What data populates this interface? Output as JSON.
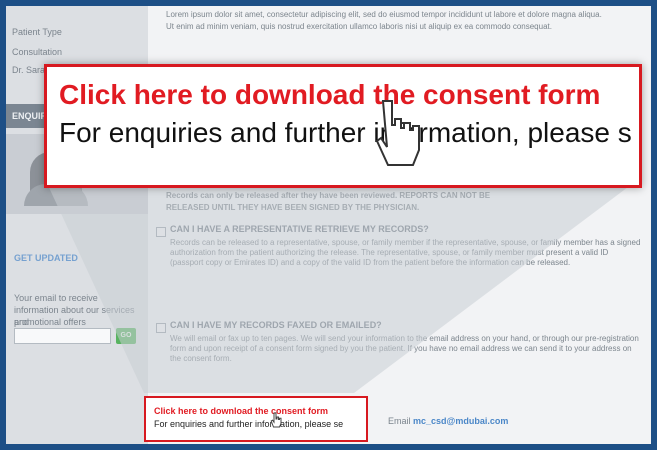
{
  "sidebar": {
    "labels": [
      "Patient Type",
      "Consultation",
      "Dr. Sarah",
      "ENQUIRIES",
      "GET UPDATED",
      "Your email to receive",
      "information about our services and",
      "promotional offers"
    ],
    "search_label": "GO"
  },
  "faq": {
    "intro_lines": [
      "Lorem ipsum dolor sit amet, consectetur adipiscing elit, sed do eiusmod tempor incididunt ut labore et dolore magna aliqua.",
      "Ut enim ad minim veniam, quis nostrud exercitation ullamco laboris nisi ut aliquip ex ea commodo consequat."
    ],
    "warning_line1": "RELEASED UNTIL THEY HAVE BEEN SIGNED BY THE PHYSICIAN.",
    "warning_line0": "Records can only be released after they have been reviewed. REPORTS CAN NOT BE",
    "q1_title": "CAN I HAVE A REPRESENTATIVE RETRIEVE MY RECORDS?",
    "q1_body": "Records can be released to a representative, spouse, or family member if the representative, spouse, or family member has a signed authorization from the patient authorizing the release. The representative, spouse, or family member must present a valid ID (passport copy or Emirates ID) and a copy of the valid ID from the patient before the information can be released.",
    "q2_title": "CAN I HAVE MY RECORDS FAXED OR EMAILED?",
    "q2_body": "We will email or fax up to ten pages. We will send your information to the email address on your hand, or through our pre-registration form and upon receipt of a consent form signed by you the patient. If you have no email address we can send it to your address on the consent form.",
    "email_link": "mc_csd@mdubai.com",
    "footer_left": "Email"
  },
  "callout_big": {
    "line1": "Click here to download the consent form",
    "line2": "For enquiries and further information, please s"
  },
  "callout_small": {
    "line1": "Click here to download the consent form",
    "line2": "For enquiries and further information, please se"
  },
  "colors": {
    "frame": "#1d4f86",
    "accent_red": "#e11b22",
    "border_red": "#d71920",
    "link_blue": "#4b87c8"
  }
}
